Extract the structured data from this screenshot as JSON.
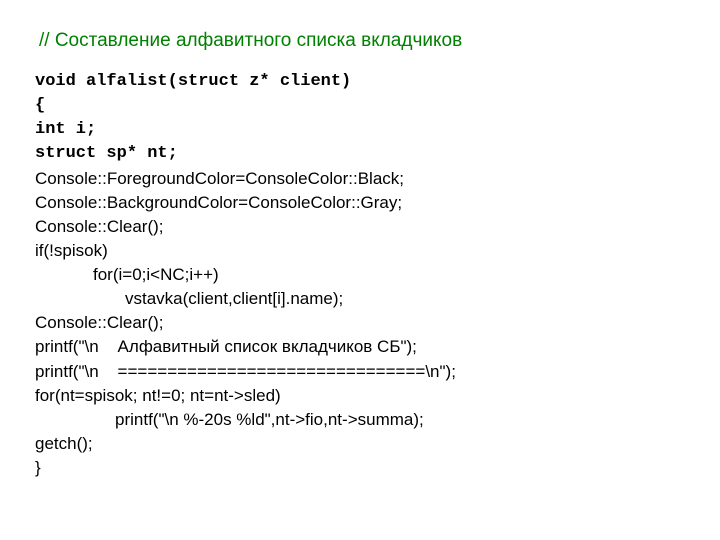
{
  "comment": " // Составление алфавитного списка вкладчиков",
  "code": {
    "l1": "void alfalist(struct z* client)",
    "l2": "{",
    "l3": "int i;",
    "l4": "struct sp* nt;",
    "l5": "Console::ForegroundColor=ConsoleColor::Black;",
    "l6": "Console::BackgroundColor=ConsoleColor::Gray;",
    "l7": "Console::Clear();",
    "l8": "if(!spisok)",
    "l9": "for(i=0;i<NC;i++)",
    "l10": "vstavka(client,client[i].name);",
    "l11": "",
    "l12": "Console::Clear();",
    "l13": "printf(\"\\n    Алфавитный список вкладчиков СБ\");",
    "l14": "printf(\"\\n    ===============================\\n\");",
    "l15": "for(nt=spisok; nt!=0; nt=nt->sled)",
    "l16": "printf(\"\\n %-20s %ld\",nt->fio,nt->summa);",
    "l17": "getch();",
    "l18": "}"
  }
}
